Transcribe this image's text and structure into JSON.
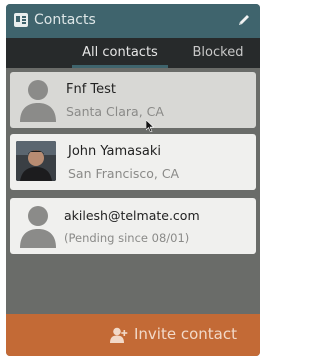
{
  "header": {
    "title": "Contacts",
    "app_icon": "contacts-app-icon",
    "edit_icon": "pencil-icon",
    "bar_color": "#3f646d"
  },
  "tabs": [
    {
      "label": "All contacts",
      "active": true
    },
    {
      "label": "Blocked",
      "active": false
    }
  ],
  "contacts": [
    {
      "name": "Fnf Test",
      "subtitle": "Santa Clara, CA",
      "avatar": "person-placeholder-icon",
      "selected": true
    },
    {
      "name": "John Yamasaki",
      "subtitle": "San Francisco, CA",
      "avatar": "profile-photo"
    },
    {
      "name": "akilesh@telmate.com",
      "subtitle": "(Pending since 08/01)",
      "avatar": "person-placeholder-icon"
    }
  ],
  "footer": {
    "invite_label": "Invite contact",
    "invite_icon": "add-person-icon",
    "button_color": "#c36a36"
  }
}
